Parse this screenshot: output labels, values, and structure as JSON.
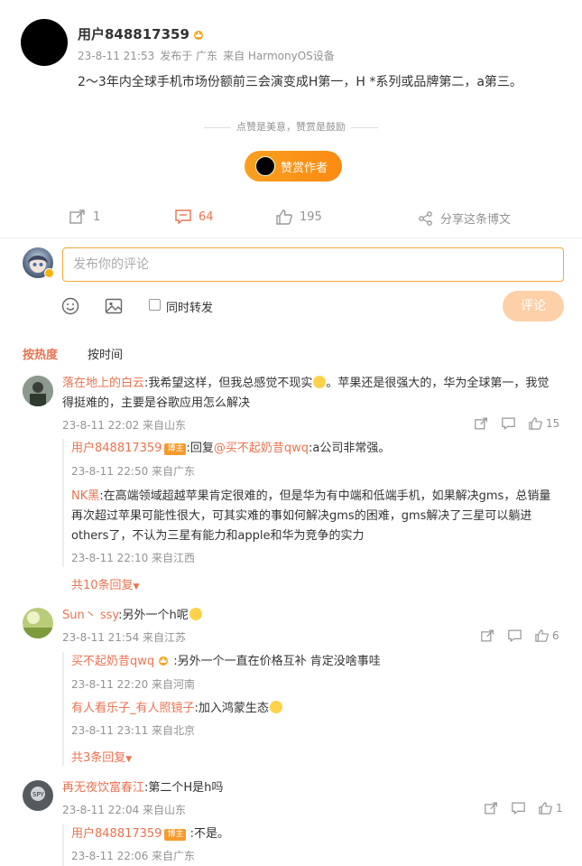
{
  "post": {
    "username": "用户848817359",
    "time": "23-8-11 21:53",
    "location": "发布于 广东",
    "source": "来自 HarmonyOS设备",
    "text": "2～3年内全球手机市场份额前三会演变成H第一，H *系列或品牌第二，a第三。",
    "like_hint": "点赞是美意，赞赏是鼓励",
    "tip_label": "赞赏作者"
  },
  "actions": {
    "repost_count": "1",
    "comment_count": "64",
    "like_count": "195",
    "share_label": "分享这条博文"
  },
  "composer": {
    "placeholder": "发布你的评论",
    "repost_label": "同时转发",
    "submit_label": "评论"
  },
  "sort": {
    "hot": "按热度",
    "time": "按时间"
  },
  "comments": [
    {
      "name": "落在地上的白云",
      "text_line1": ":我希望这样，但我总感觉不现实",
      "text_line1b": "。苹果还是很强大的，华为全球第一，我觉",
      "text_line2": "得挺难的，主要是谷歌应用怎么解决",
      "meta": "23-8-11 22:02 来自山东",
      "likes": "15",
      "replies": [
        {
          "name": "用户848817359",
          "badge": "博主",
          "text_prefix": ":回复",
          "mention": "@买不起奶昔qwq",
          "text": ":a公司非常强。",
          "meta": "23-8-11 22:50 来自广东"
        },
        {
          "name": "NK黑",
          "text1": ":在高端领域超越苹果肯定很难的，但是华为有中端和低端手机，如果解决gms，总销量",
          "text2": "再次超过苹果可能性很大，可其实难的事如何解决gms的困难，gms解决了三星可以躺进",
          "text3": "others了，不认为三星有能力和apple和华为竞争的实力",
          "meta": "23-8-11 22:10 来自江西"
        }
      ],
      "more": "共10条回复"
    },
    {
      "name": "Sun丶 ssy",
      "text": ":另外一个h呢",
      "meta": "23-8-11 21:54 来自江苏",
      "likes": "6",
      "replies": [
        {
          "name": "买不起奶昔qwq",
          "text": " :另外一个一直在价格互补 肯定没啥事哇",
          "meta": "23-8-11 22:20 来自河南"
        },
        {
          "name": "有人看乐子_有人照镜子",
          "text": ":加入鸿蒙生态",
          "meta": "23-8-11 23:11 来自北京"
        }
      ],
      "more": "共3条回复"
    },
    {
      "name": "再无夜饮富春江",
      "text": ":第二个H是h吗",
      "meta": "23-8-11 22:04 来自山东",
      "likes": "1",
      "replies": [
        {
          "name": "用户848817359",
          "badge": "博主",
          "text": " :不是。",
          "meta": "23-8-11 22:06 来自广东"
        }
      ]
    }
  ],
  "colors": {
    "accent": "#eb7350",
    "tip_button": "#fc8a12",
    "input_border": "#f4a93a",
    "submit_disabled": "#fdd0a8"
  }
}
